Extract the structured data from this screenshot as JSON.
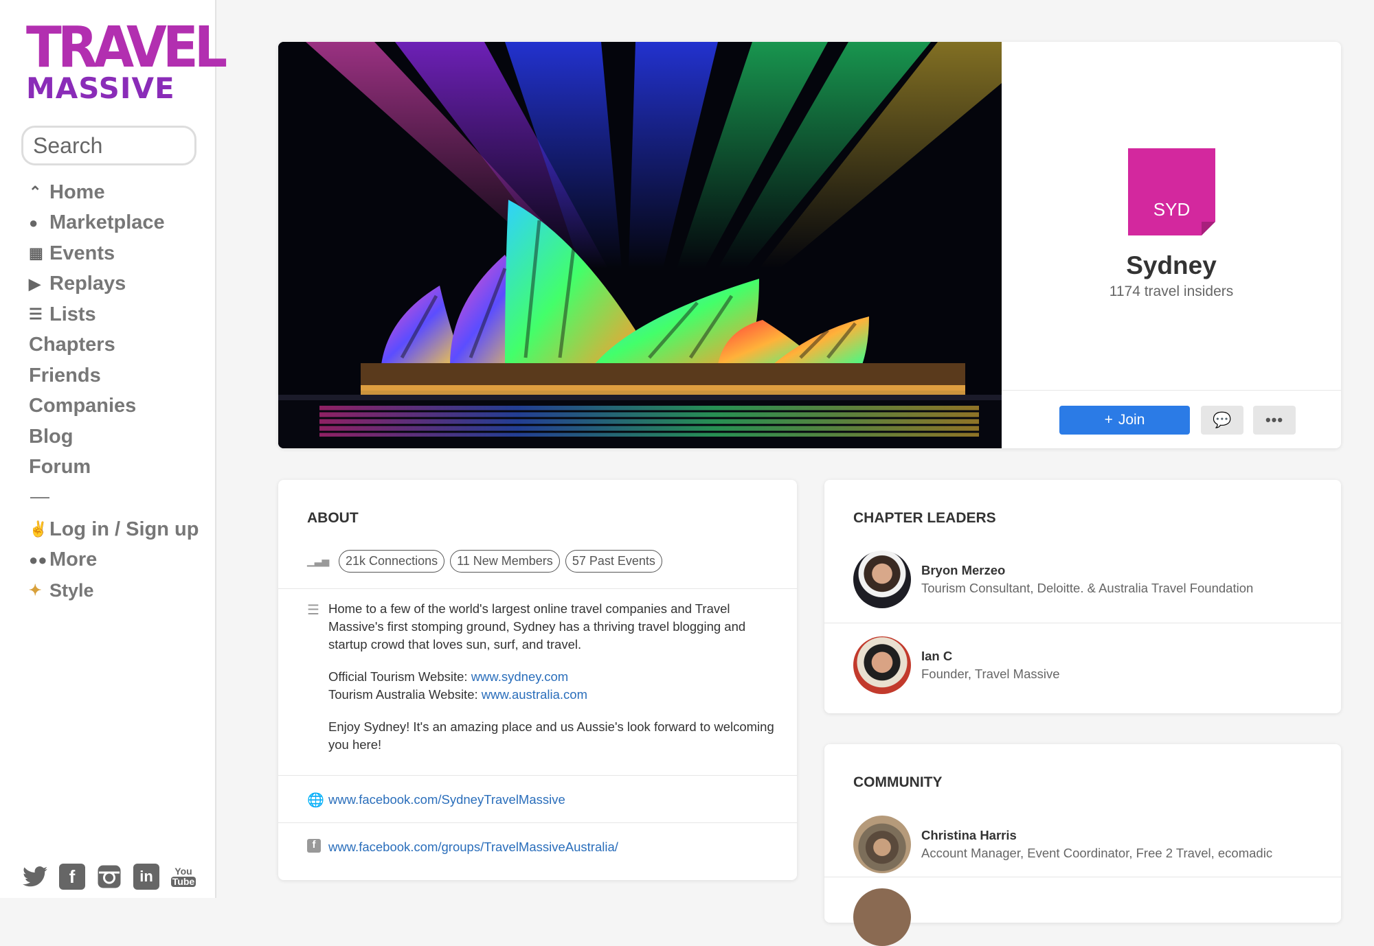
{
  "logo": {
    "line1": "TRAVEL",
    "line2": "MASSIVE"
  },
  "search": {
    "placeholder": "Search"
  },
  "nav": {
    "home": "Home",
    "marketplace": "Marketplace",
    "events": "Events",
    "replays": "Replays",
    "lists": "Lists",
    "chapters": "Chapters",
    "friends": "Friends",
    "companies": "Companies",
    "blog": "Blog",
    "forum": "Forum",
    "separator": "—",
    "login": "Log in / Sign up",
    "more": "More",
    "style": "Style"
  },
  "socials": [
    "twitter-icon",
    "facebook-icon",
    "instagram-icon",
    "linkedin-icon",
    "youtube-icon"
  ],
  "hero": {
    "badge": "SYD",
    "name": "Sydney",
    "count": "1174 travel insiders",
    "join_label": "Join",
    "badge_color": "#d3289e",
    "join_color": "#2b7be6"
  },
  "about": {
    "title": "ABOUT",
    "stats": [
      "21k Connections",
      "11 New Members",
      "57 Past Events"
    ],
    "paragraph1": "Home to a few of the world's largest online travel companies and Travel Massive's first stomping ground, Sydney has a thriving travel blogging and startup crowd that loves sun, surf, and travel.",
    "official_label": "Official Tourism Website: ",
    "official_link": "www.sydney.com",
    "australia_label": "Tourism Australia Website: ",
    "australia_link": "www.australia.com",
    "paragraph3": "Enjoy Sydney! It's an amazing place and us Aussie's look forward to welcoming you here!",
    "website_link": "www.facebook.com/SydneyTravelMassive",
    "facebook_link": "www.facebook.com/groups/TravelMassiveAustralia/"
  },
  "leaders": {
    "title": "CHAPTER LEADERS",
    "people": [
      {
        "name": "Bryon Merzeo",
        "role": "Tourism Consultant, Deloitte. & Australia Travel Foundation"
      },
      {
        "name": "Ian C",
        "role": "Founder, Travel Massive"
      }
    ]
  },
  "community": {
    "title": "COMMUNITY",
    "people": [
      {
        "name": "Christina Harris",
        "role": "Account Manager, Event Coordinator, Free 2 Travel, ecomadic"
      }
    ]
  }
}
